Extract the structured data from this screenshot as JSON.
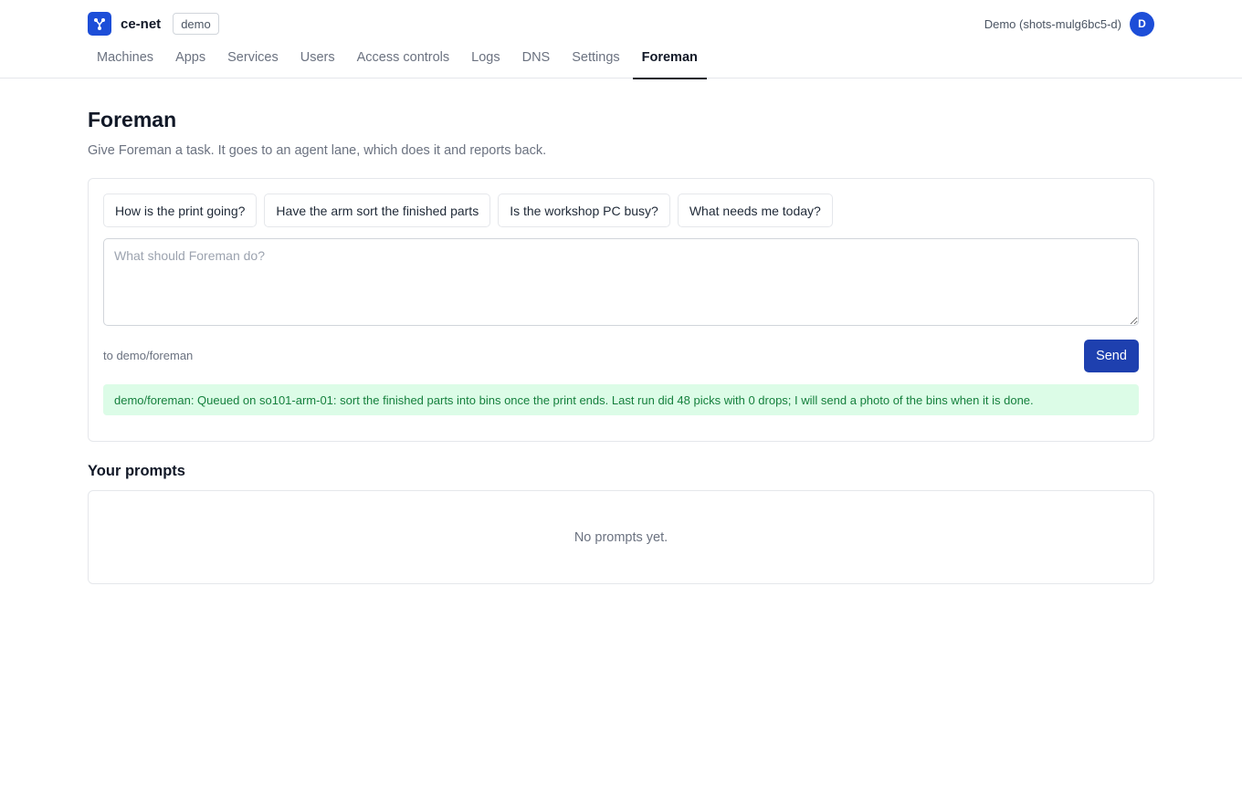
{
  "app": {
    "name": "ce-net",
    "environment_badge": "demo",
    "logo_icon": "network-nodes-icon",
    "accent_color": "#1d4ed8"
  },
  "user": {
    "display_name": "Demo (shots-mulg6bc5-d)",
    "avatar_initial": "D"
  },
  "nav": {
    "items": [
      {
        "label": "Machines",
        "active": false
      },
      {
        "label": "Apps",
        "active": false
      },
      {
        "label": "Services",
        "active": false
      },
      {
        "label": "Users",
        "active": false
      },
      {
        "label": "Access controls",
        "active": false
      },
      {
        "label": "Logs",
        "active": false
      },
      {
        "label": "DNS",
        "active": false
      },
      {
        "label": "Settings",
        "active": false
      },
      {
        "label": "Foreman",
        "active": true
      }
    ]
  },
  "page": {
    "title": "Foreman",
    "subtitle": "Give Foreman a task. It goes to an agent lane, which does it and reports back."
  },
  "composer": {
    "suggestions": [
      "How is the print going?",
      "Have the arm sort the finished parts",
      "Is the workshop PC busy?",
      "What needs me today?"
    ],
    "placeholder": "What should Foreman do?",
    "value": "",
    "target_label": "to demo/foreman",
    "send_label": "Send",
    "status_message": "demo/foreman: Queued on so101-arm-01: sort the finished parts into bins once the print ends. Last run did 48 picks with 0 drops; I will send a photo of the bins when it is done.",
    "status_color": "#15803d"
  },
  "prompts": {
    "title": "Your prompts",
    "empty_text": "No prompts yet."
  }
}
